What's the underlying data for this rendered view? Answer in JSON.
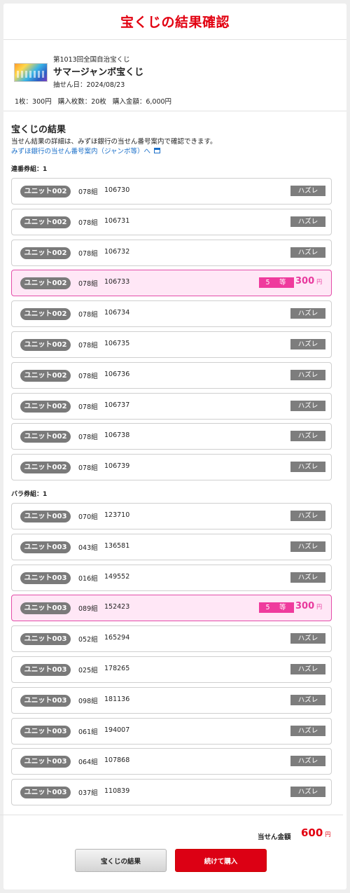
{
  "header": {
    "title": "宝くじの結果確認"
  },
  "lottery": {
    "series": "第1013回全国自治宝くじ",
    "name": "サマージャンボ宝くじ",
    "draw_date": "抽せん日：2024/08/23",
    "price": "1枚：300円",
    "count": "購入枚数：20枚",
    "amount": "購入金額：6,000円"
  },
  "results": {
    "title": "宝くじの結果",
    "description": "当せん結果の詳細は、みずほ銀行の当せん番号案内で確認できます。",
    "link": "みずほ銀行の当せん番号案内（ジャンボ等）へ",
    "group1_label": "連番券組：1",
    "group2_label": "バラ券組：1",
    "lose_label": "ハズレ",
    "rank_label": "5　等",
    "prize_value": "300",
    "yen": "円",
    "group1": [
      {
        "unit": "ユニット002",
        "kumi": "078組",
        "number": "106730",
        "win": false
      },
      {
        "unit": "ユニット002",
        "kumi": "078組",
        "number": "106731",
        "win": false
      },
      {
        "unit": "ユニット002",
        "kumi": "078組",
        "number": "106732",
        "win": false
      },
      {
        "unit": "ユニット002",
        "kumi": "078組",
        "number": "106733",
        "win": true
      },
      {
        "unit": "ユニット002",
        "kumi": "078組",
        "number": "106734",
        "win": false
      },
      {
        "unit": "ユニット002",
        "kumi": "078組",
        "number": "106735",
        "win": false
      },
      {
        "unit": "ユニット002",
        "kumi": "078組",
        "number": "106736",
        "win": false
      },
      {
        "unit": "ユニット002",
        "kumi": "078組",
        "number": "106737",
        "win": false
      },
      {
        "unit": "ユニット002",
        "kumi": "078組",
        "number": "106738",
        "win": false
      },
      {
        "unit": "ユニット002",
        "kumi": "078組",
        "number": "106739",
        "win": false
      }
    ],
    "group2": [
      {
        "unit": "ユニット003",
        "kumi": "070組",
        "number": "123710",
        "win": false
      },
      {
        "unit": "ユニット003",
        "kumi": "043組",
        "number": "136581",
        "win": false
      },
      {
        "unit": "ユニット003",
        "kumi": "016組",
        "number": "149552",
        "win": false
      },
      {
        "unit": "ユニット003",
        "kumi": "089組",
        "number": "152423",
        "win": true
      },
      {
        "unit": "ユニット003",
        "kumi": "052組",
        "number": "165294",
        "win": false
      },
      {
        "unit": "ユニット003",
        "kumi": "025組",
        "number": "178265",
        "win": false
      },
      {
        "unit": "ユニット003",
        "kumi": "098組",
        "number": "181136",
        "win": false
      },
      {
        "unit": "ユニット003",
        "kumi": "061組",
        "number": "194007",
        "win": false
      },
      {
        "unit": "ユニット003",
        "kumi": "064組",
        "number": "107868",
        "win": false
      },
      {
        "unit": "ユニット003",
        "kumi": "037組",
        "number": "110839",
        "win": false
      }
    ]
  },
  "footer": {
    "total_label": "当せん金額",
    "total_value": "600",
    "yen": "円",
    "results_button": "宝くじの結果",
    "buy_button": "続けて購入"
  }
}
